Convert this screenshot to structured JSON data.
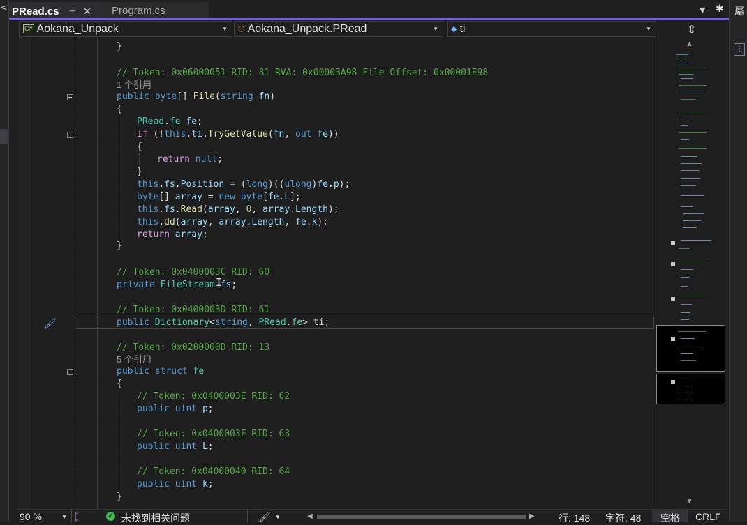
{
  "tabs": [
    {
      "label": "PRead.cs",
      "active": true
    },
    {
      "label": "Program.cs",
      "active": false
    }
  ],
  "tab_icons": {
    "pin": "⊣",
    "close": "✕",
    "dropdown": "▼",
    "settings": "✱"
  },
  "navbar": {
    "project": "Aokana_Unpack",
    "project_icon": "C#",
    "type": "Aokana_Unpack.PRead",
    "member": "ti"
  },
  "right_panel": {
    "title": "屬"
  },
  "code": {
    "closing_brace_top": "}",
    "file_comment": "// Token: 0x06000051 RID: 81 RVA: 0x00003A98 File Offset: 0x00001E98",
    "file_refs": "1 个引用",
    "fs_comment": "// Token: 0x0400003C RID: 60",
    "ti_comment": "// Token: 0x0400003D RID: 61",
    "fe_comment": "// Token: 0x0200000D RID: 13",
    "fe_refs": "5 个引用",
    "p_comment": "// Token: 0x0400003E RID: 62",
    "L_comment": "// Token: 0x0400003F RID: 63",
    "k_comment": "// Token: 0x04000040 RID: 64"
  },
  "statusbar": {
    "zoom": "90 %",
    "issues": "未找到相关问题",
    "line": "行: 148",
    "col": "字符: 48",
    "spaces": "空格",
    "eol": "CRLF"
  },
  "colors": {
    "accent": "#7160e8",
    "keyword": "#569cd6",
    "type": "#4ec9b0",
    "comment": "#57a64a",
    "method": "#dcdcaa",
    "ok": "#3fb950"
  }
}
